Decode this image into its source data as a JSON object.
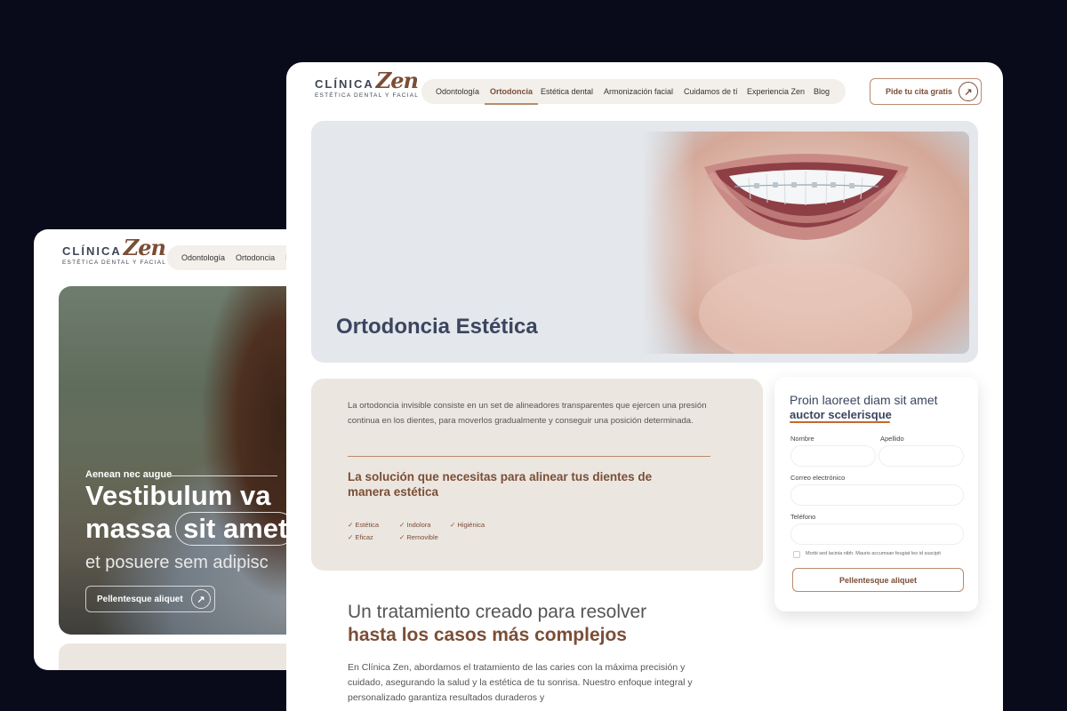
{
  "brand": {
    "name_word": "CLÍNICA",
    "name_script": "Zen",
    "tagline": "ESTÉTICA DENTAL Y FACIAL",
    "primary_color": "#7a4e36",
    "accent_color": "#b98a6e",
    "navy_color": "#3a4660"
  },
  "back_window": {
    "nav": [
      "Odontología",
      "Ortodoncia",
      "E"
    ],
    "hero": {
      "kicker": "Aenean nec augue",
      "title_line1": "Vestibulum va",
      "title_line2_a": "massa",
      "title_line2_b": "sit amet",
      "subtitle": "et posuere sem adipisc",
      "cta": "Pellentesque aliquet",
      "cta_icon": "arrow-up-right-icon"
    }
  },
  "main_window": {
    "nav": [
      {
        "label": "Odontología",
        "active": false
      },
      {
        "label": "Ortodoncia",
        "active": true
      },
      {
        "label": "Estética dental",
        "active": false
      },
      {
        "label": "Armonización facial",
        "active": false
      },
      {
        "label": "Cuidamos de tí",
        "active": false
      },
      {
        "label": "Experiencia Zen",
        "active": false
      },
      {
        "label": "Blog",
        "active": false
      }
    ],
    "cta": "Pide tu cita gratis",
    "cta_icon": "arrow-up-right-icon",
    "hero_title": "Ortodoncia Estética",
    "description": {
      "paragraph": "La ortodoncia invisible consiste en un set de alineadores transparentes que ejercen una presión continua en los dientes, para moverlos gradualmente y conseguir una posición determinada.",
      "heading": "La solución que necesitas para alinear tus dientes de manera estética",
      "checks": [
        "Estética",
        "Indolora",
        "Higiénica",
        "Eficaz",
        "Removible"
      ]
    },
    "form": {
      "title_line1": "Proin laoreet diam sit amet",
      "title_line2": "auctor scelerisque",
      "fields": {
        "nombre": "Nombre",
        "apellido": "Apellido",
        "email": "Correo electrónico",
        "telefono": "Teléfono"
      },
      "consent": "Morbi sed lacinia nibh. Mauris accumsan feugiat leo id suscipit",
      "submit": "Pellentesque aliquet"
    },
    "section": {
      "title_light": "Un tratamiento creado para resolver",
      "title_bold": "hasta los casos más complejos",
      "paragraph": "En Clínica Zen, abordamos el tratamiento de las caries con la máxima precisión y cuidado, asegurando la salud y la estética de tu sonrisa. Nuestro enfoque integral y personalizado garantiza resultados duraderos y"
    }
  }
}
